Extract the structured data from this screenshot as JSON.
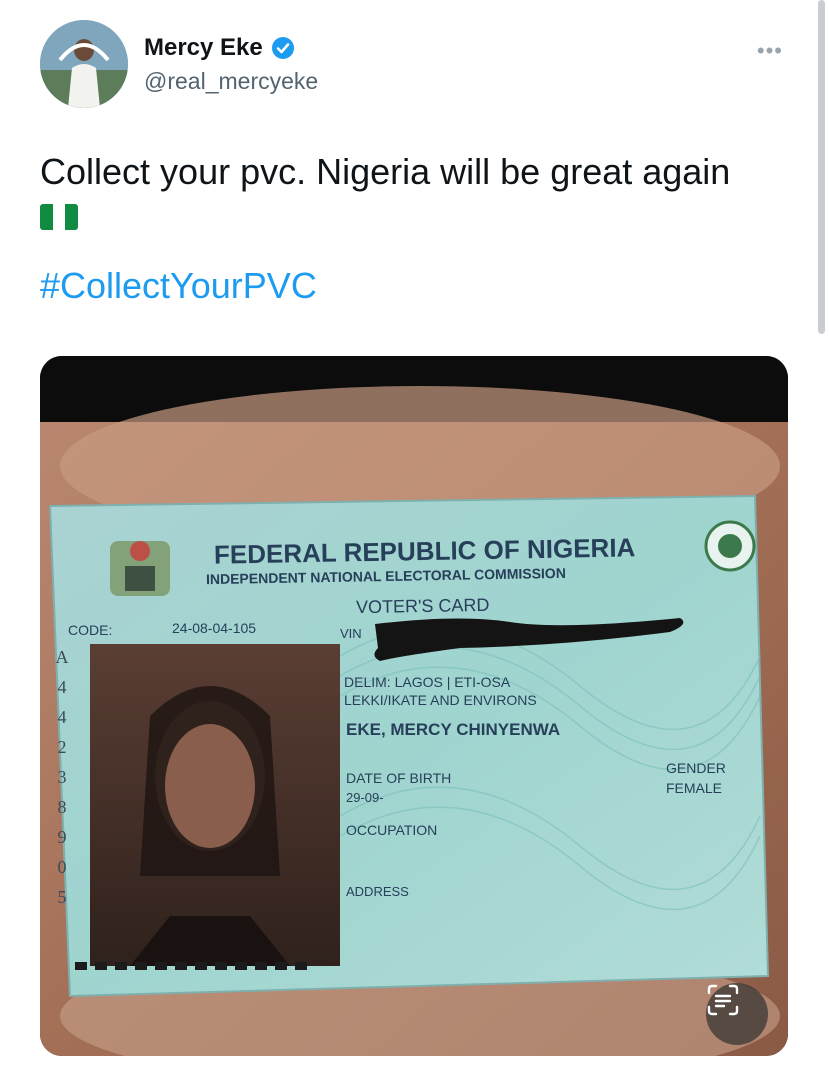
{
  "author": {
    "display_name": "Mercy Eke",
    "handle": "@real_mercyeke",
    "verified_icon": "verified-badge-icon",
    "more_icon": "ellipsis-icon"
  },
  "tweet": {
    "text": "Collect your pvc. Nigeria will be great again",
    "flag_emoji": "nigeria-flag",
    "hashtag": "#CollectYourPVC"
  },
  "card": {
    "title": "FEDERAL REPUBLIC OF NIGERIA",
    "subtitle": "INDEPENDENT NATIONAL ELECTORAL COMMISSION",
    "card_type": "VOTER'S CARD",
    "code_label": "CODE:",
    "code_value": "24-08-04-105",
    "vin_label": "VIN",
    "delim": "DELIM: LAGOS  |  ETI-OSA",
    "area": "LEKKI/IKATE AND ENVIRONS",
    "full_name": "EKE, MERCY CHINYENWA",
    "dob_label": "DATE OF BIRTH",
    "dob_value": "29-09-",
    "gender_label": "GENDER",
    "gender_value": "FEMALE",
    "occupation_label": "OCCUPATION",
    "address_label": "ADDRESS",
    "side_digits": [
      "A",
      "4",
      "4",
      "2",
      "3",
      "8",
      "9",
      "0",
      "5"
    ]
  },
  "colors": {
    "link": "#1d9bf0",
    "secondary_text": "#536471",
    "verified": "#1d9bf0"
  },
  "media_icon": "visual-lookup-icon"
}
